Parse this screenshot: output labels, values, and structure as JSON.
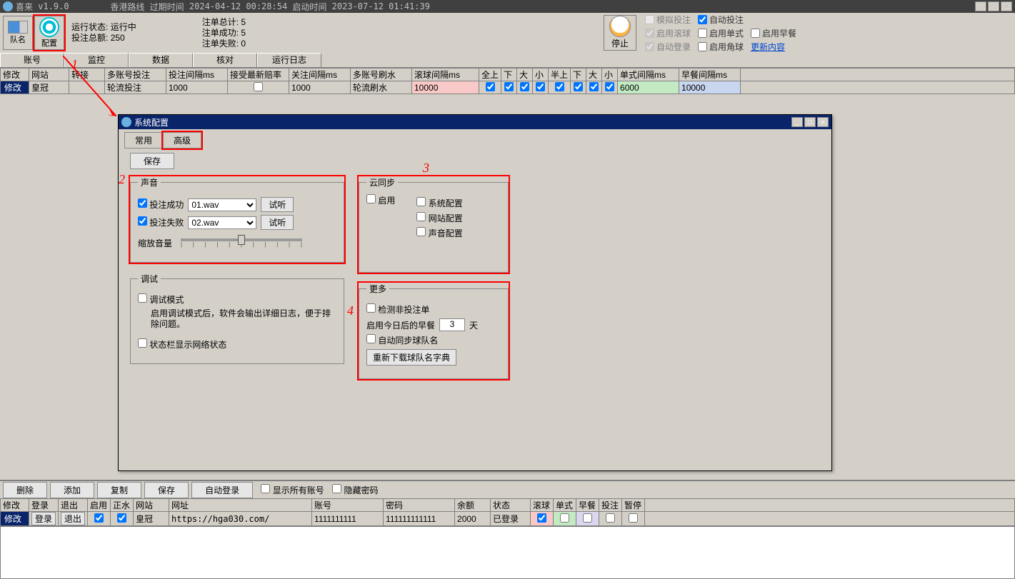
{
  "titlebar": {
    "app": "喜来",
    "version": "v1.9.0",
    "route": "香港路线",
    "expire_label": "过期时间",
    "expire_time": "2024-04-12 00:28:54",
    "start_label": "启动时间",
    "start_time": "2023-07-12 01:41:39"
  },
  "toolbar": {
    "btn_team": "队名",
    "btn_config": "配置",
    "status_label": "运行状态:",
    "status_value": "运行中",
    "total_label": "投注总额:",
    "total_value": "250",
    "order_total": "注单总计:",
    "order_total_v": "5",
    "order_ok": "注单成功:",
    "order_ok_v": "5",
    "order_fail": "注单失败:",
    "order_fail_v": "0",
    "stop": "停止"
  },
  "opts": {
    "sim": "模拟投注",
    "auto": "自动投注",
    "roll": "启用滚球",
    "single": "启用单式",
    "breakfast": "启用早餐",
    "autologin": "自动登录",
    "corner": "启用角球",
    "update": "更新内容"
  },
  "tabs": [
    "账号",
    "监控",
    "数据",
    "核对",
    "运行日志"
  ],
  "grid": {
    "headers": [
      "修改",
      "网站",
      "转接",
      "多账号投注",
      "投注间隔ms",
      "接受最新赔率",
      "关注间隔ms",
      "多账号刷水",
      "滚球间隔ms",
      "全上",
      "下",
      "大",
      "小",
      "半上",
      "下",
      "大",
      "小",
      "单式间隔ms",
      "早餐间隔ms"
    ],
    "row": {
      "edit": "修改",
      "site": "皇冠",
      "mode": "轮流投注",
      "bet_int": "1000",
      "watch_int": "1000",
      "brush": "轮流刷水",
      "roll_int": "10000",
      "single_int": "6000",
      "break_int": "10000"
    }
  },
  "dialog": {
    "title": "系统配置",
    "tab_normal": "常用",
    "tab_adv": "高级",
    "save": "保存",
    "sound": {
      "legend": "声音",
      "ok": "投注成功",
      "ok_file": "01.wav",
      "fail": "投注失败",
      "fail_file": "02.wav",
      "try": "试听",
      "volume": "缩放音量"
    },
    "cloud": {
      "legend": "云同步",
      "enable": "启用",
      "sys": "系统配置",
      "site": "网站配置",
      "sound": "声音配置"
    },
    "debug": {
      "legend": "调试",
      "mode": "调试模式",
      "hint": "启用调试模式后，软件会输出详细日志，便于排除问题。",
      "statusbar": "状态栏显示网络状态"
    },
    "more": {
      "legend": "更多",
      "nonbet": "检测非投注单",
      "breakfast_days": "启用今日后的早餐",
      "days_v": "3",
      "days_unit": "天",
      "autosync": "自动同步球队名",
      "redownload": "重新下载球队名字典"
    }
  },
  "annot": {
    "n1": "1",
    "n2": "2",
    "n3": "3",
    "n4": "4"
  },
  "bottom": {
    "del": "删除",
    "add": "添加",
    "copy": "复制",
    "save": "保存",
    "autologin": "自动登录",
    "showall": "显示所有账号",
    "hidepw": "隐藏密码",
    "headers": [
      "修改",
      "登录",
      "退出",
      "启用",
      "正水",
      "网站",
      "网址",
      "账号",
      "密码",
      "余额",
      "状态",
      "滚球",
      "单式",
      "早餐",
      "投注",
      "暂停"
    ],
    "row": {
      "edit": "修改",
      "login": "登录",
      "logout": "退出",
      "site": "皇冠",
      "url": "https://hga030.com/",
      "acct": "1111111111",
      "pw": "111111111111",
      "bal": "2000",
      "stat": "已登录"
    }
  }
}
